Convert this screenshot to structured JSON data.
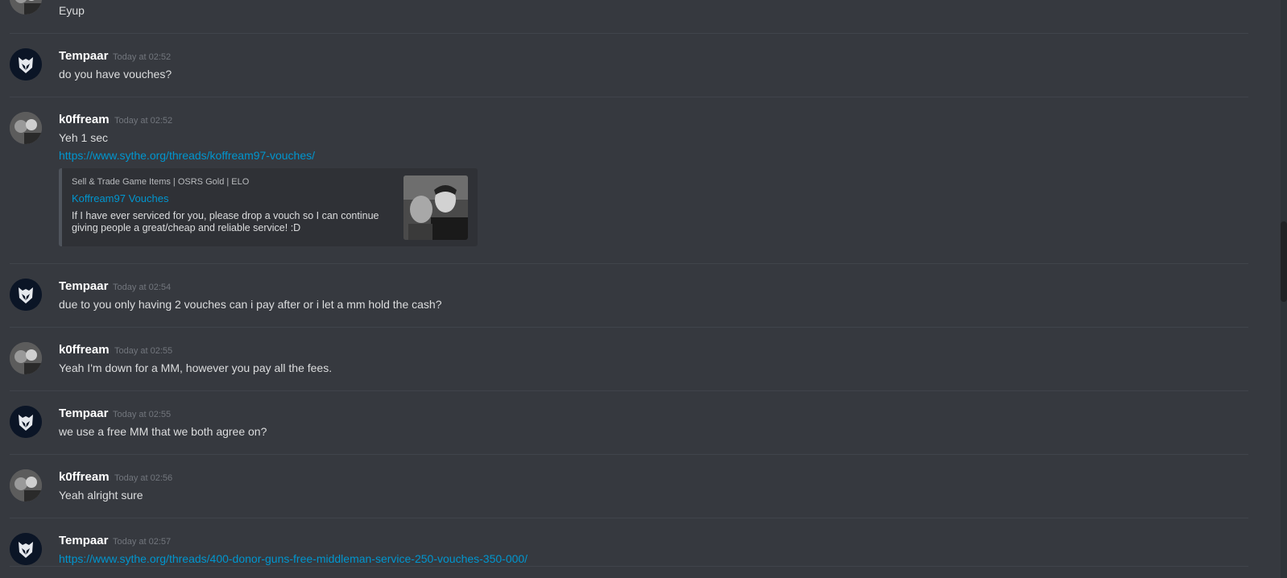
{
  "messages": [
    {
      "author": "",
      "time": "",
      "text": "Eyup",
      "avatar": "koff-avatar"
    },
    {
      "author": "Tempaar",
      "time": "Today at 02:52",
      "text": "do you have vouches?",
      "avatar": "tempaar-avatar"
    },
    {
      "author": "k0ffream",
      "time": "Today at 02:52",
      "text": "Yeh 1 sec",
      "link": "https://www.sythe.org/threads/koffream97-vouches/",
      "avatar": "koff-avatar",
      "embed": {
        "provider": "Sell & Trade Game Items | OSRS Gold | ELO",
        "title": "Koffream97 Vouches",
        "description": "If I have ever serviced for you, please drop a vouch so I can continue giving people a great/cheap and reliable service! :D"
      }
    },
    {
      "author": "Tempaar",
      "time": "Today at 02:54",
      "text": "due to you only having 2 vouches can i pay after or i let a mm hold the cash?",
      "avatar": "tempaar-avatar"
    },
    {
      "author": "k0ffream",
      "time": "Today at 02:55",
      "text": "Yeah I'm down for a MM, however you pay all the fees.",
      "avatar": "koff-avatar"
    },
    {
      "author": "Tempaar",
      "time": "Today at 02:55",
      "text": "we use a free MM that we both agree on?",
      "avatar": "tempaar-avatar"
    },
    {
      "author": "k0ffream",
      "time": "Today at 02:56",
      "text": "Yeah alright sure",
      "avatar": "koff-avatar"
    },
    {
      "author": "Tempaar",
      "time": "Today at 02:57",
      "link": "https://www.sythe.org/threads/400-donor-guns-free-middleman-service-250-vouches-350-000/",
      "avatar": "tempaar-avatar"
    }
  ],
  "colors": {
    "background": "#36393f",
    "link": "#0096cf",
    "username": "#ffffff",
    "timestamp": "#72767d"
  }
}
